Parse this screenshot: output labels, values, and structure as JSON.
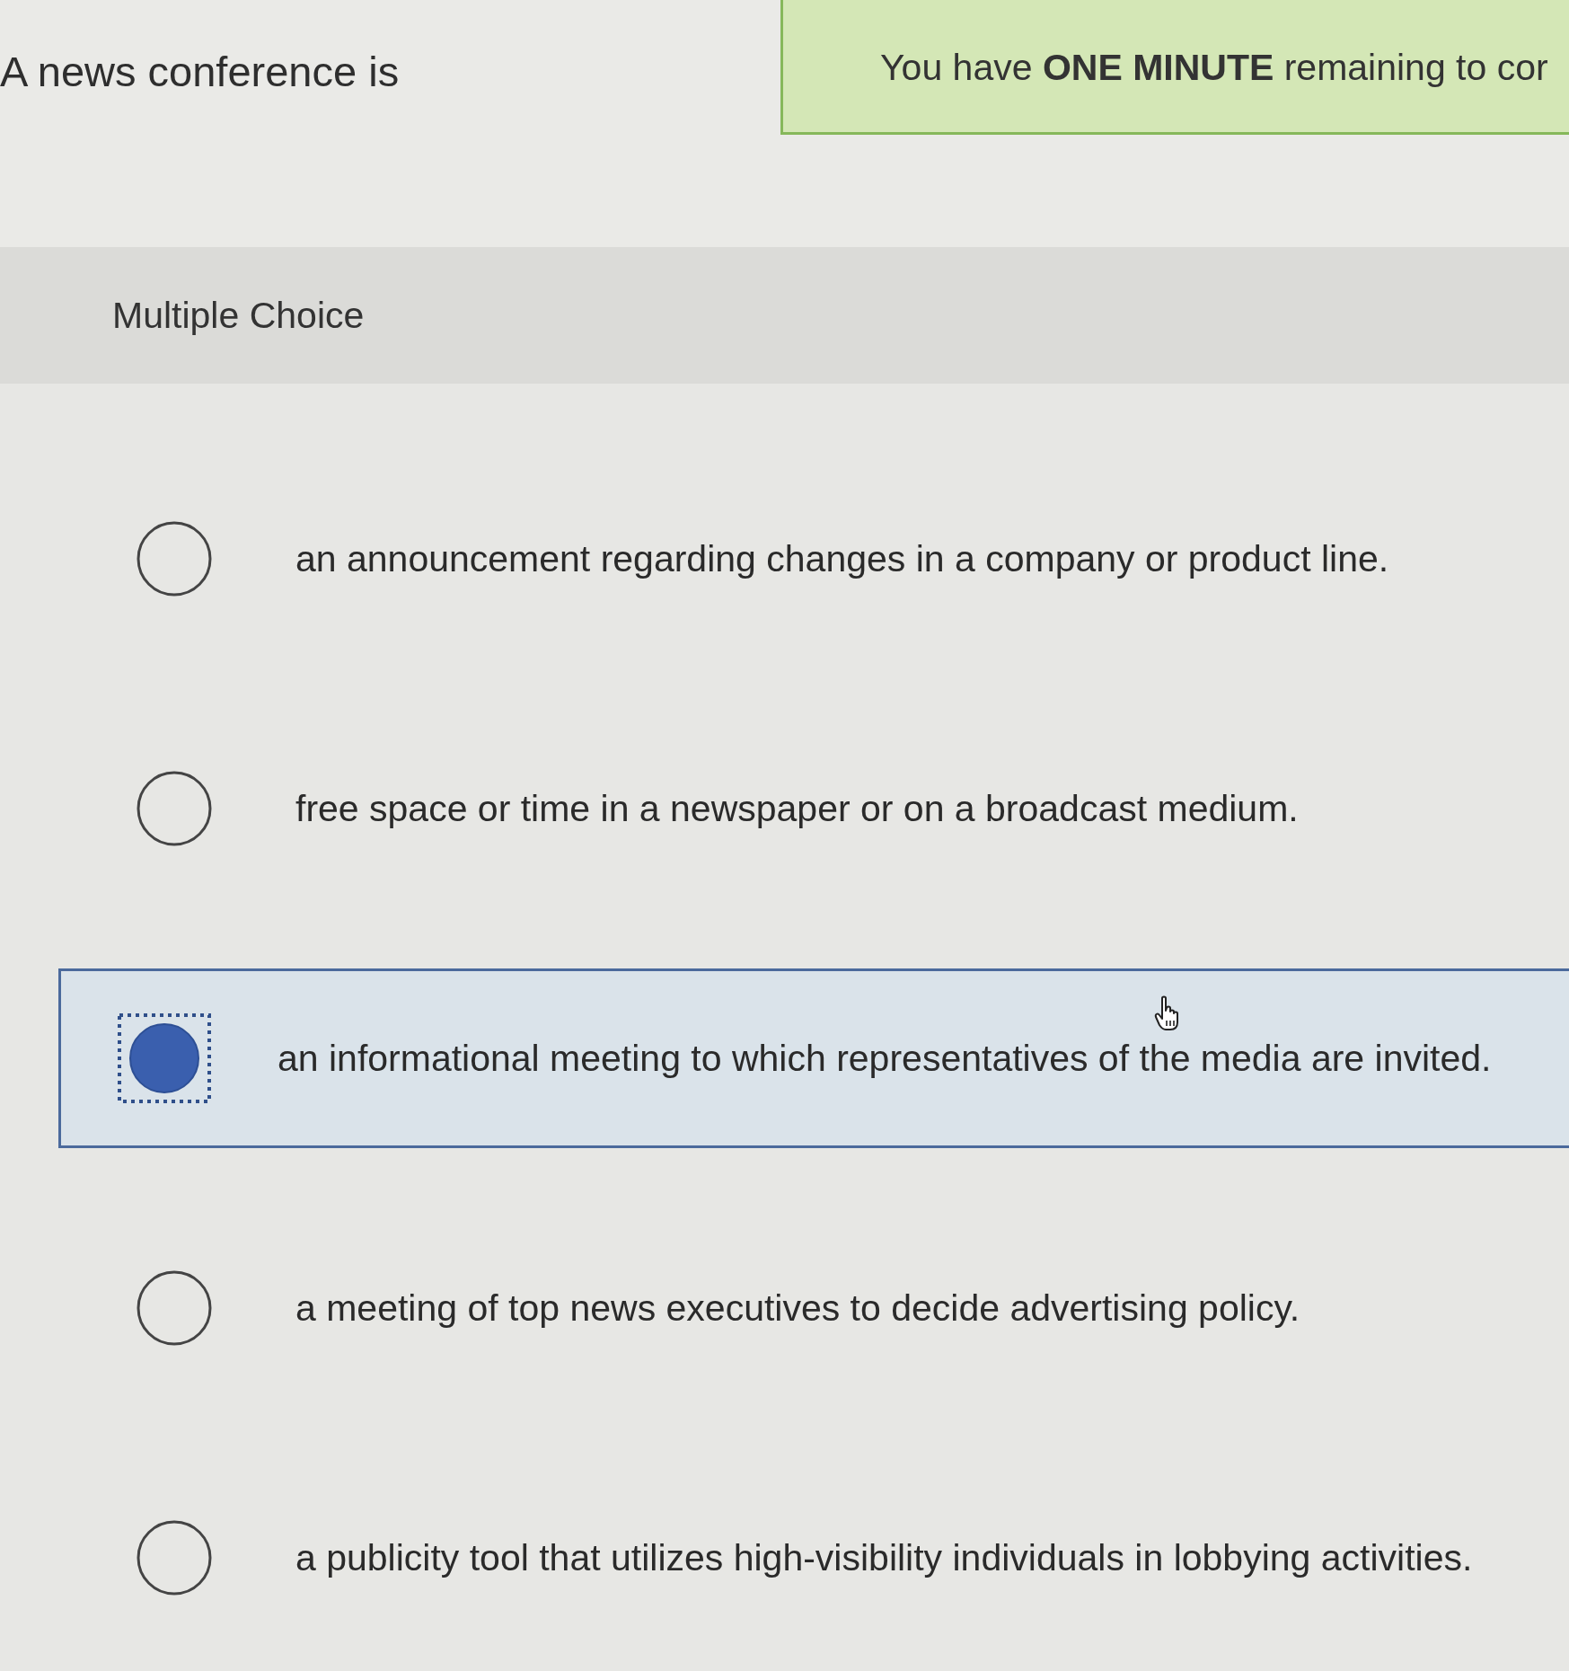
{
  "question": {
    "text": "A news conference is"
  },
  "timer_banner": {
    "text": "You have **ONE MINUTE** remaining to cor"
  },
  "question_type": {
    "label": "Multiple Choice"
  },
  "options": [
    {
      "label": "an announcement regarding changes in a company or product line.",
      "selected": false
    },
    {
      "label": "free space or time in a newspaper or on a broadcast medium.",
      "selected": false
    },
    {
      "label": "an informational meeting to which representatives of the media are invited.",
      "selected": true
    },
    {
      "label": "a meeting of top news executives to decide advertising policy.",
      "selected": false
    },
    {
      "label": "a publicity tool that utilizes high-visibility individuals in lobbying activities.",
      "selected": false
    }
  ]
}
